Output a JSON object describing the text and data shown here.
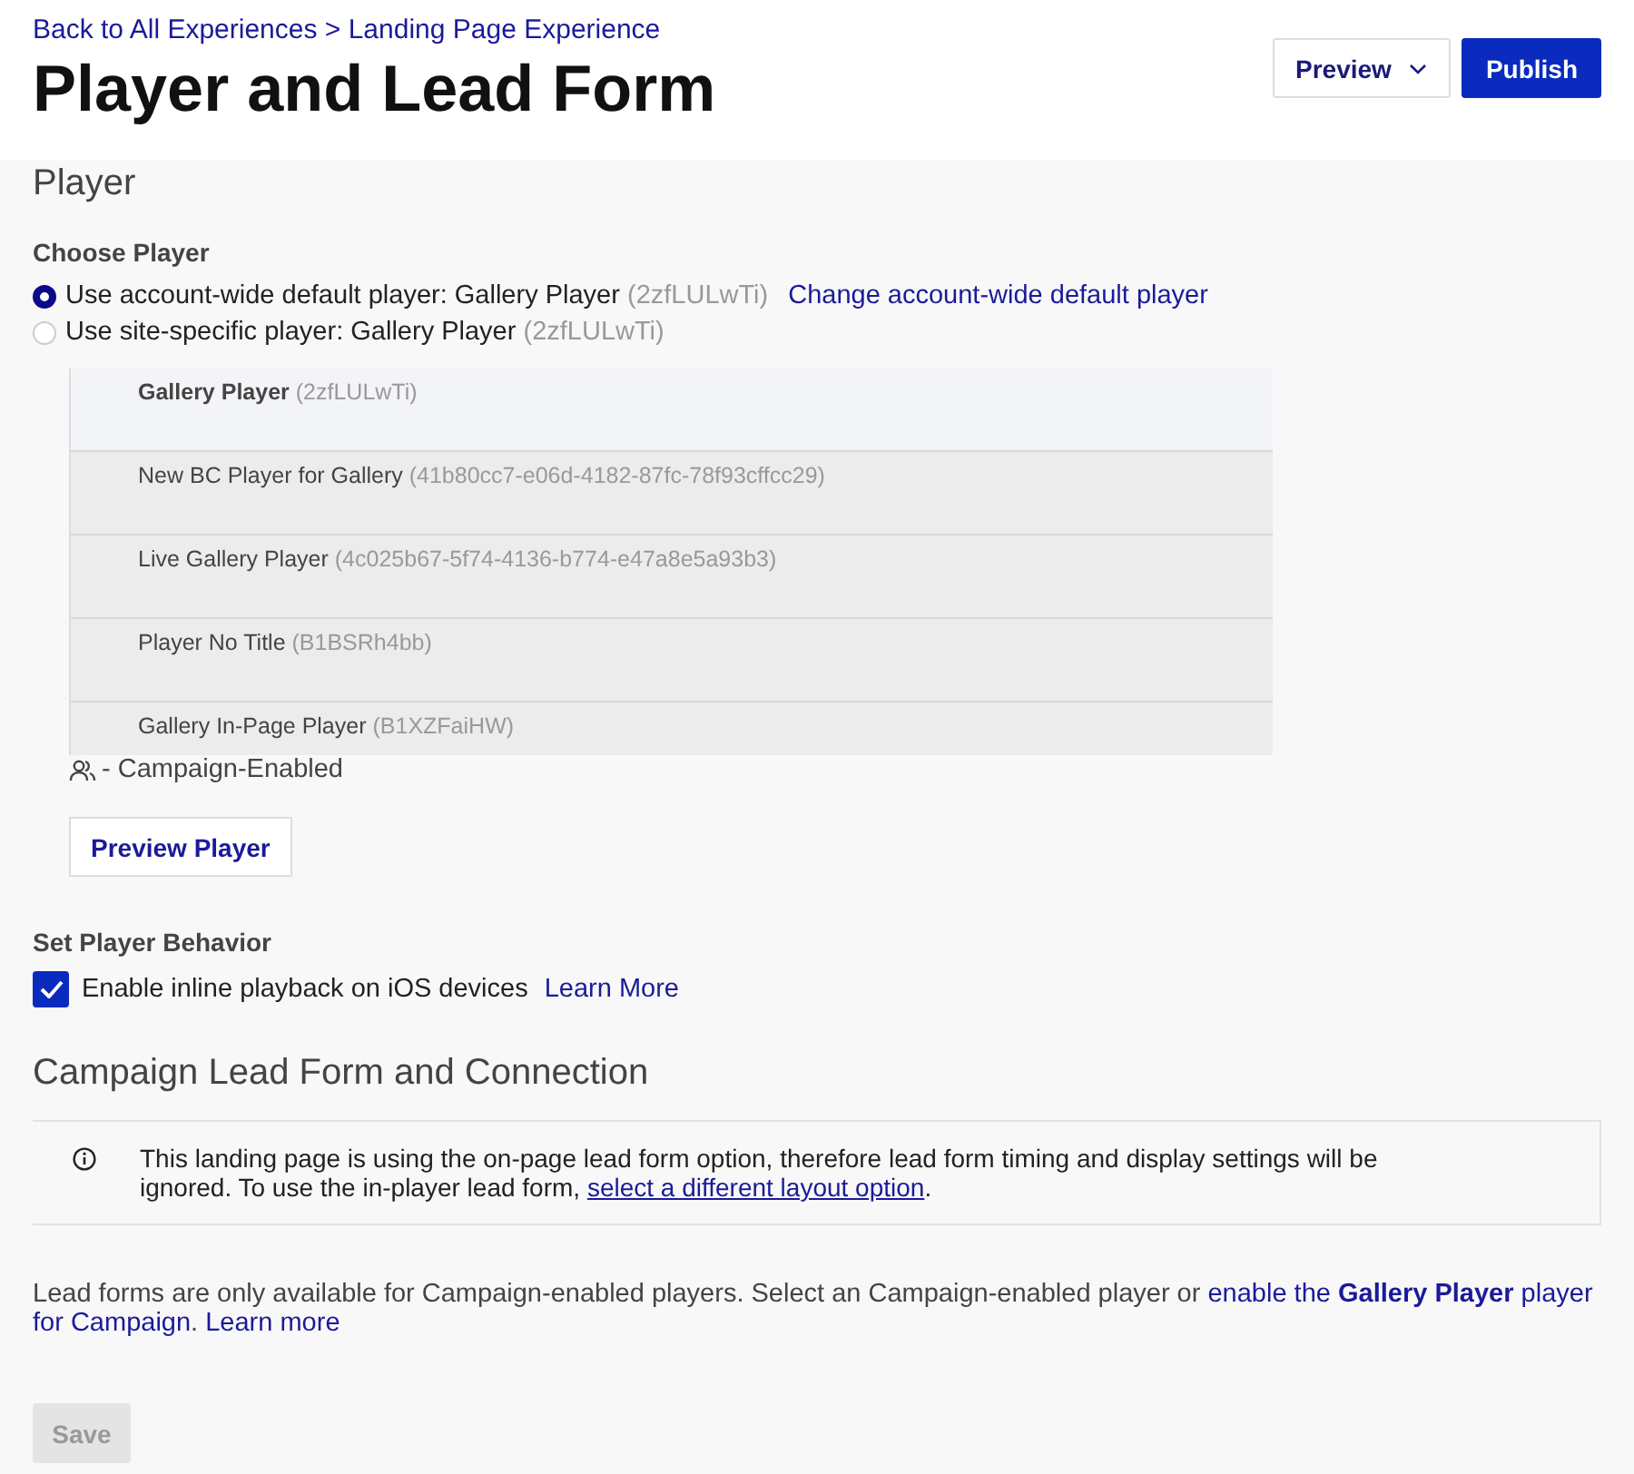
{
  "breadcrumb": "Back to All Experiences > Landing Page Experience",
  "title": "Player and Lead Form",
  "header_buttons": [
    {
      "label": "Preview",
      "kind": "dropdown"
    },
    {
      "label": "Publish",
      "kind": "primary"
    }
  ],
  "player_section": {
    "heading": "Player",
    "choose_label": "Choose Player",
    "options": [
      {
        "label": "Use account-wide default player: Gallery Player",
        "id": "(2zfLULwTi)",
        "link": "Change account-wide default player",
        "selected": true
      },
      {
        "label": "Use site-specific player: Gallery Player",
        "id": "(2zfLULwTi)",
        "selected": false
      }
    ],
    "players": [
      {
        "name": "Gallery Player",
        "id": "(2zfLULwTi)",
        "selected": true
      },
      {
        "name": "New BC Player for Gallery",
        "id": "(41b80cc7-e06d-4182-87fc-78f93cffcc29)",
        "selected": false
      },
      {
        "name": "Live Gallery Player",
        "id": "(4c025b67-5f74-4136-b774-e47a8e5a93b3)",
        "selected": false
      },
      {
        "name": "Player No Title",
        "id": "(B1BSRh4bb)",
        "selected": false
      },
      {
        "name": "Gallery In-Page Player",
        "id": "(B1XZFaiHW)",
        "selected": false
      }
    ],
    "legend": "- Campaign-Enabled",
    "preview_button": "Preview Player"
  },
  "behavior": {
    "heading": "Set Player Behavior",
    "checkbox_label": "Enable inline playback on iOS devices",
    "checked": true,
    "link": "Learn More"
  },
  "lead_form": {
    "heading": "Campaign Lead Form and Connection",
    "notice": {
      "text": "This landing page is using the on-page lead form option, therefore lead form timing and display settings will be ignored. To use the in-player lead form, ",
      "link": "select a different layout option",
      "end": "."
    },
    "note": [
      {
        "kind": "text",
        "text": "Lead forms are only available for Campaign-enabled players. Select an Campaign-enabled player or "
      },
      {
        "kind": "link",
        "text": "enable the **Gallery Player** player"
      },
      {
        "kind": "link",
        "text": "for Campaign"
      },
      {
        "kind": "text",
        "text": ". "
      },
      {
        "kind": "link",
        "text": "Learn more"
      }
    ]
  },
  "save_button": {
    "label": "Save",
    "disabled": true
  }
}
